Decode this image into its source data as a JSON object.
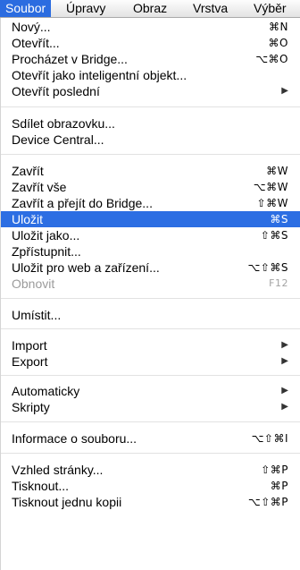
{
  "menubar": {
    "items": [
      "Soubor",
      "Úpravy",
      "Obraz",
      "Vrstva",
      "Výběr"
    ]
  },
  "menu": {
    "items": [
      {
        "label": "Nový...",
        "shortcut": "⌘N"
      },
      {
        "label": "Otevřít...",
        "shortcut": "⌘O"
      },
      {
        "label": "Procházet v Bridge...",
        "shortcut": "⌥⌘O"
      },
      {
        "label": "Otevřít jako inteligentní objekt...",
        "shortcut": ""
      },
      {
        "label": "Otevřít poslední",
        "shortcut": ""
      },
      {
        "label": "Sdílet obrazovku...",
        "shortcut": ""
      },
      {
        "label": "Device Central...",
        "shortcut": ""
      },
      {
        "label": "Zavřít",
        "shortcut": "⌘W"
      },
      {
        "label": "Zavřít vše",
        "shortcut": "⌥⌘W"
      },
      {
        "label": "Zavřít a přejít do Bridge...",
        "shortcut": "⇧⌘W"
      },
      {
        "label": "Uložit",
        "shortcut": "⌘S"
      },
      {
        "label": "Uložit jako...",
        "shortcut": "⇧⌘S"
      },
      {
        "label": "Zpřístupnit...",
        "shortcut": ""
      },
      {
        "label": "Uložit pro web a zařízení...",
        "shortcut": "⌥⇧⌘S"
      },
      {
        "label": "Obnovit",
        "shortcut": "F12"
      },
      {
        "label": "Umístit...",
        "shortcut": ""
      },
      {
        "label": "Import",
        "shortcut": ""
      },
      {
        "label": "Export",
        "shortcut": ""
      },
      {
        "label": "Automaticky",
        "shortcut": ""
      },
      {
        "label": "Skripty",
        "shortcut": ""
      },
      {
        "label": "Informace o souboru...",
        "shortcut": "⌥⇧⌘I"
      },
      {
        "label": "Vzhled stránky...",
        "shortcut": "⇧⌘P"
      },
      {
        "label": "Tisknout...",
        "shortcut": "⌘P"
      },
      {
        "label": "Tisknout jednu kopii",
        "shortcut": "⌥⇧⌘P"
      }
    ],
    "submenu_arrow_icon": "triangle-right-icon",
    "highlighted_item": "Uložit",
    "disabled_item": "Obnovit"
  }
}
